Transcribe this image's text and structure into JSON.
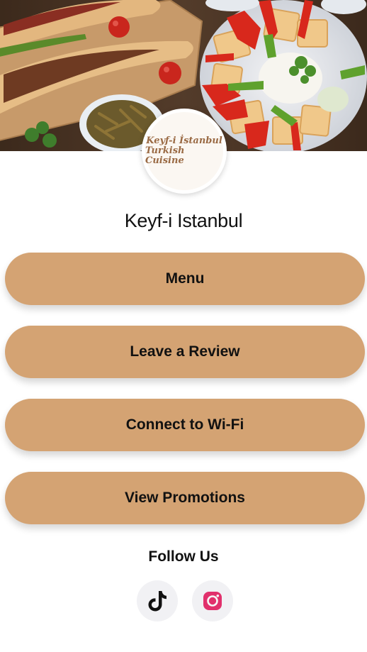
{
  "hero": {
    "image_description": "",
    "logo": {
      "line1": "Keyf-i İstanbul",
      "line2": "Turkish Cuisine"
    }
  },
  "restaurant": {
    "name": "Keyf-i Istanbul"
  },
  "buttons": {
    "menu": "Menu",
    "review": "Leave a Review",
    "wifi": "Connect to Wi-Fi",
    "promotions": "View Promotions"
  },
  "social": {
    "heading": "Follow Us",
    "links": [
      {
        "icon": "tiktok-icon"
      },
      {
        "icon": "instagram-icon"
      }
    ]
  },
  "colors": {
    "button": "#d4a373",
    "instagram": "#e1306c"
  }
}
